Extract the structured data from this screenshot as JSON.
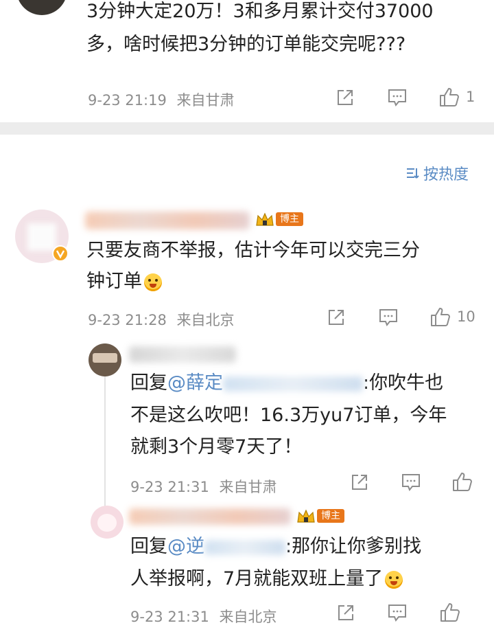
{
  "top_comment": {
    "text_line1": "3分钟大定20万！3和多月累计交付37000",
    "text_line2": "多，啥时候把3分钟的订单能交完呢???",
    "time": "9-23 21:19",
    "location": "来自甘肃",
    "like_count": "1"
  },
  "sort": {
    "label": "按热度"
  },
  "comment": {
    "badge": "博主",
    "text_line1": "只要友商不举报，估计今年可以交完三分",
    "text_line2": "钟订单",
    "time": "9-23 21:28",
    "location": "来自北京",
    "like_count": "10"
  },
  "reply1": {
    "reply_prefix": "回复",
    "mention": "@薛定",
    "text_line1_rest": ":你吹牛也",
    "text_line2": "不是这么吹吧！16.3万yu7订单，今年",
    "text_line3": "就剩3个月零7天了！",
    "time": "9-23 21:31",
    "location": "来自甘肃"
  },
  "reply2": {
    "badge": "博主",
    "reply_prefix": "回复",
    "mention": "@逆",
    "text_line1_rest": ":那你让你爹别找",
    "text_line2": "人举报啊，7月就能双班上量了",
    "time": "9-23 21:31",
    "location": "来自北京"
  },
  "colors": {
    "link": "#5a8bc4",
    "meta": "#8c8c8c",
    "badge": "#e8761a",
    "divider": "#ececec"
  },
  "icons": [
    "share-icon",
    "comment-icon",
    "like-icon",
    "sort-icon",
    "crown-icon",
    "vip-icon",
    "emoji-icon"
  ]
}
